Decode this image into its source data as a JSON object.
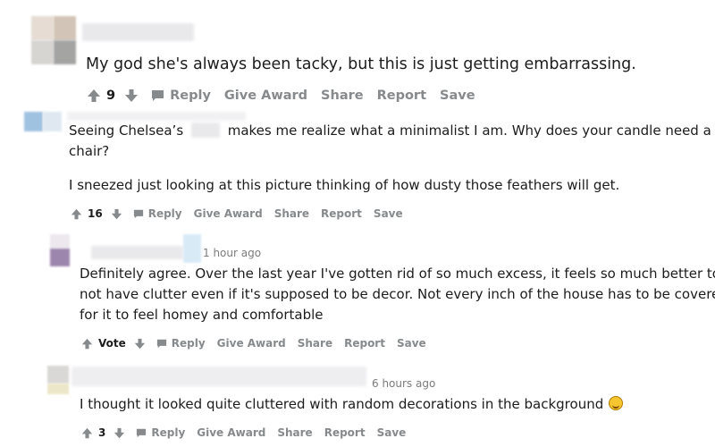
{
  "comments": [
    {
      "text": "My god she's always been tacky, but this is just getting embarrassing.",
      "votes": "9",
      "actions": {
        "reply": "Reply",
        "award": "Give Award",
        "share": "Share",
        "report": "Report",
        "save": "Save"
      }
    },
    {
      "text_before": "Seeing Chelsea’s",
      "text_after": "makes me realize what a minimalist I am. Why does your candle need a",
      "text_line2": "chair?",
      "text_para2": "I sneezed just looking at this picture thinking of how dusty those feathers will get.",
      "votes": "16",
      "actions": {
        "reply": "Reply",
        "award": "Give Award",
        "share": "Share",
        "report": "Report",
        "save": "Save"
      }
    },
    {
      "time": "1 hour ago",
      "lines": [
        "Definitely agree. Over the last year I've gotten rid of so much excess, it feels so much better to",
        "not have clutter even if it's supposed to be decor. Not every inch of the house has to be covered",
        "for it to feel homey and comfortable"
      ],
      "votes": "Vote",
      "actions": {
        "reply": "Reply",
        "award": "Give Award",
        "share": "Share",
        "report": "Report",
        "save": "Save"
      }
    },
    {
      "time": "6 hours ago",
      "text": "I thought it looked quite cluttered with random decorations in the background",
      "emoji": "crying-laughing-emoji-icon",
      "votes": "3",
      "actions": {
        "reply": "Reply",
        "award": "Give Award",
        "share": "Share",
        "report": "Report",
        "save": "Save"
      }
    }
  ],
  "colors": {
    "text": "#1c1c1c",
    "muted": "#878a8c",
    "time": "#7c7c7c"
  }
}
